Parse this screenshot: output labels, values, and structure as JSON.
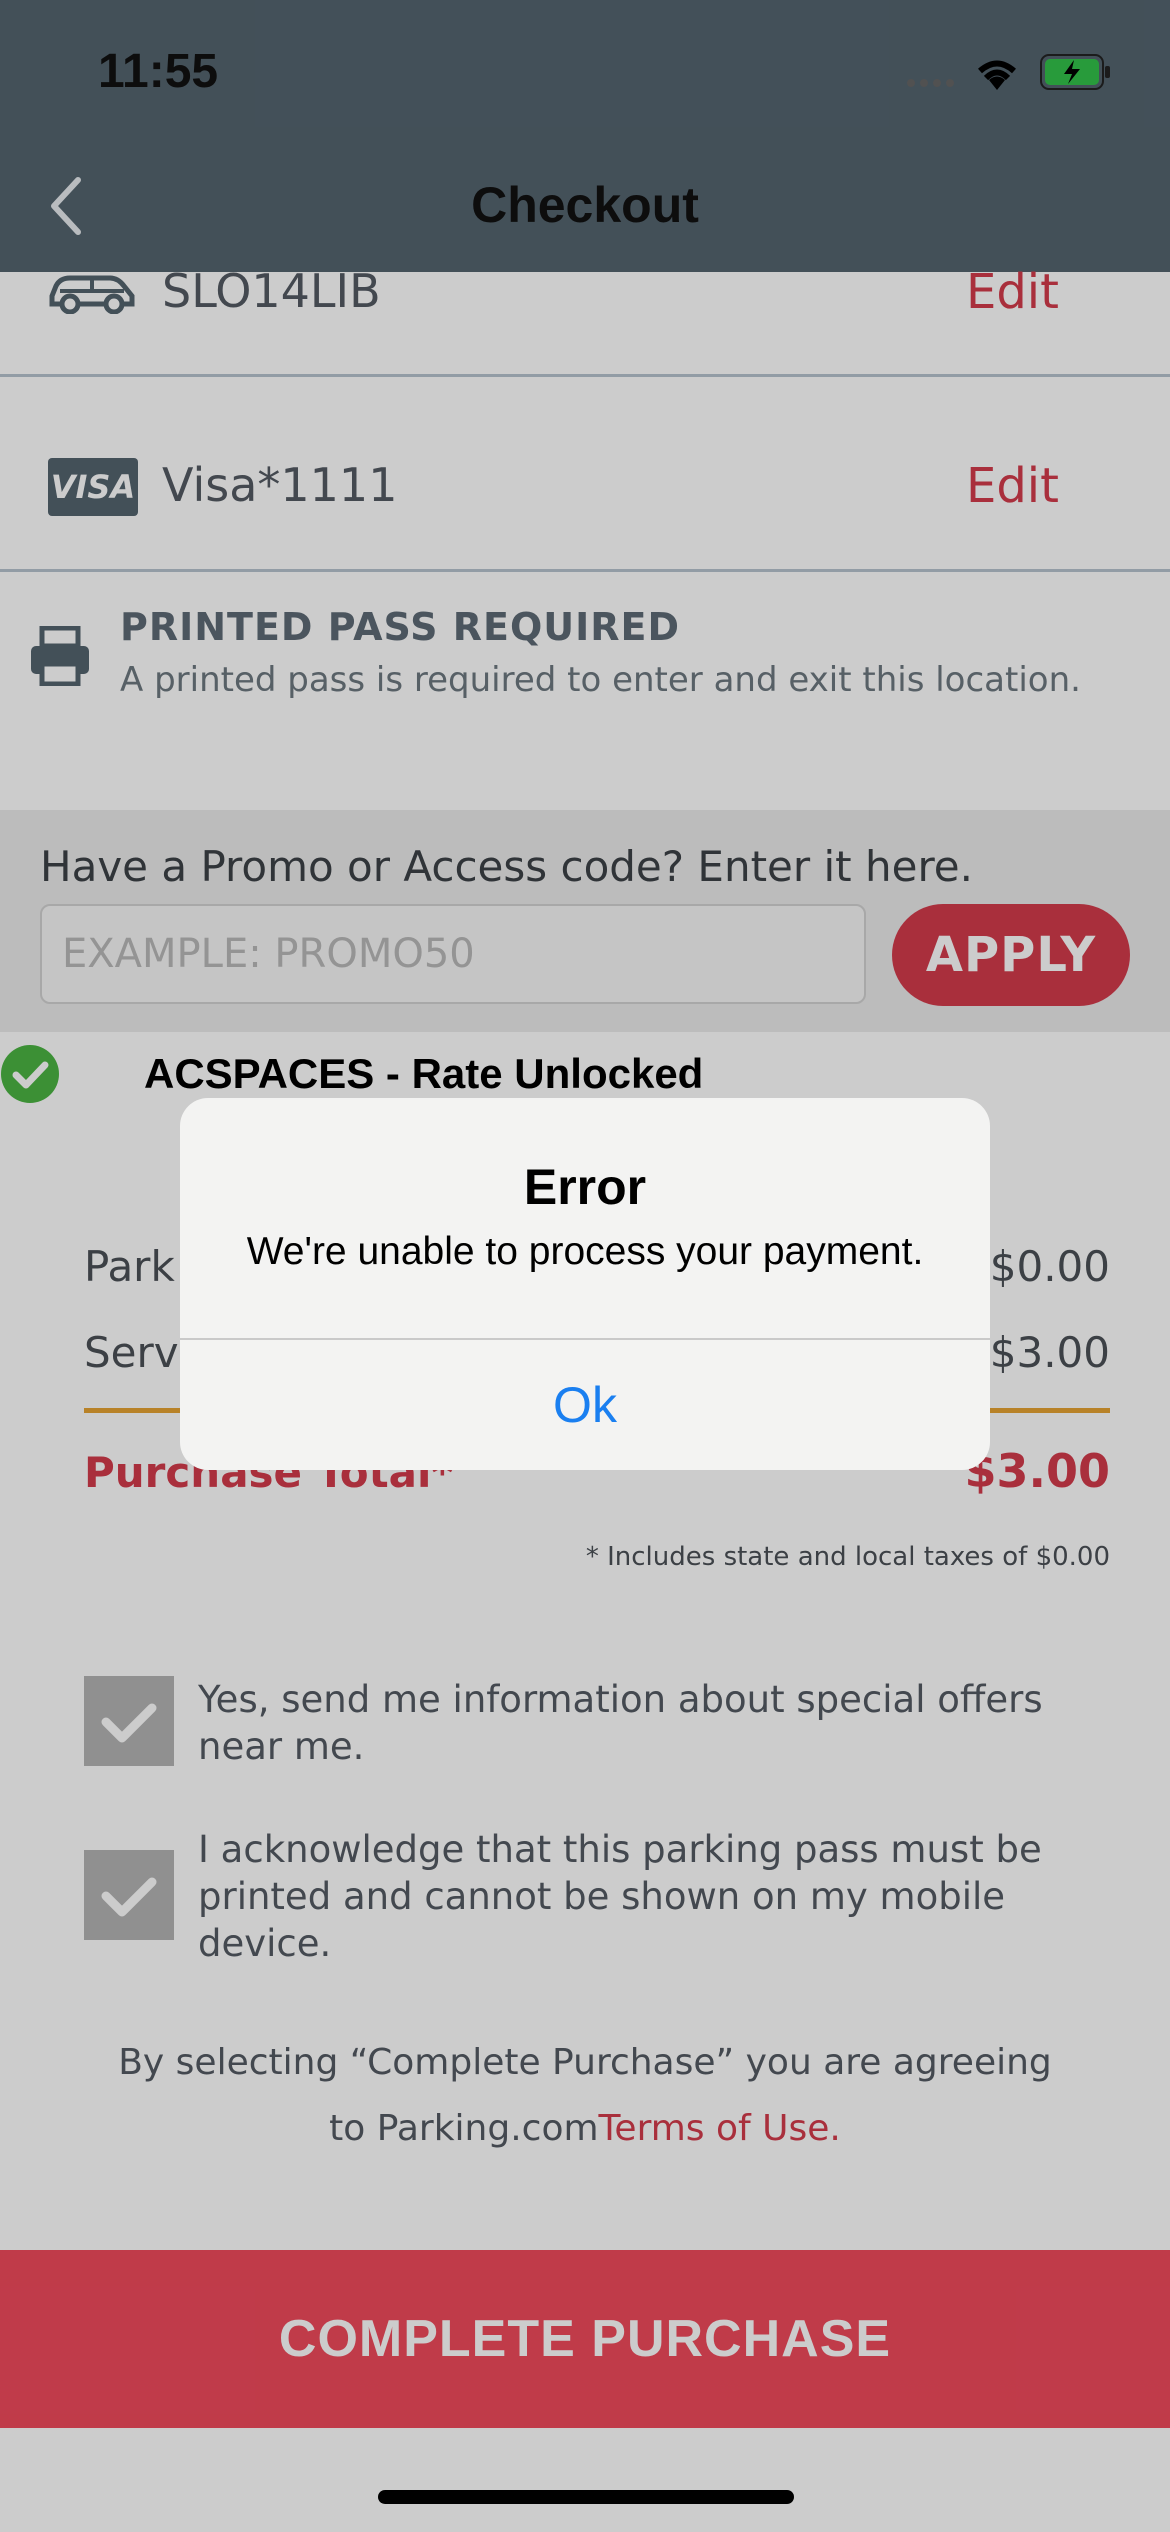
{
  "status_bar": {
    "time": "11:55"
  },
  "nav": {
    "title": "Checkout"
  },
  "vehicle": {
    "plate": "SLO14LIB",
    "edit_label": "Edit"
  },
  "payment": {
    "card_brand": "VISA",
    "card_label": "Visa*1111",
    "edit_label": "Edit"
  },
  "pass_notice": {
    "title": "PRINTED PASS REQUIRED",
    "subtitle": "A printed pass is required to enter and exit this location."
  },
  "promo": {
    "label": "Have a Promo or Access code? Enter it here.",
    "placeholder": "EXAMPLE: PROMO50",
    "apply_label": "APPLY",
    "unlocked_text": "ACSPACES - Rate Unlocked"
  },
  "summary": {
    "lines": [
      {
        "label": "Park",
        "value": "$0.00"
      },
      {
        "label": "Serv",
        "value": "$3.00"
      }
    ],
    "total_label": "Purchase Total*",
    "total_value": "$3.00",
    "tax_note": "* Includes state and local taxes of $0.00"
  },
  "options": [
    {
      "label": "Yes, send me information about special offers near me.",
      "checked": true
    },
    {
      "label": "I acknowledge that this parking pass must be printed and cannot be shown on my mobile device.",
      "checked": true
    }
  ],
  "agreement": {
    "line1": "By selecting “Complete Purchase” you are agreeing",
    "line2_prefix": "to Parking.com",
    "link": "Terms of Use."
  },
  "purchase_button": {
    "label": "COMPLETE PURCHASE"
  },
  "alert": {
    "title": "Error",
    "message": "We're unable to process your payment.",
    "ok_label": "Ok"
  },
  "colors": {
    "accent_red": "#d43b4c",
    "nav_bg": "#54646f",
    "link_blue": "#1a7ff0",
    "success_green": "#4bb543"
  }
}
